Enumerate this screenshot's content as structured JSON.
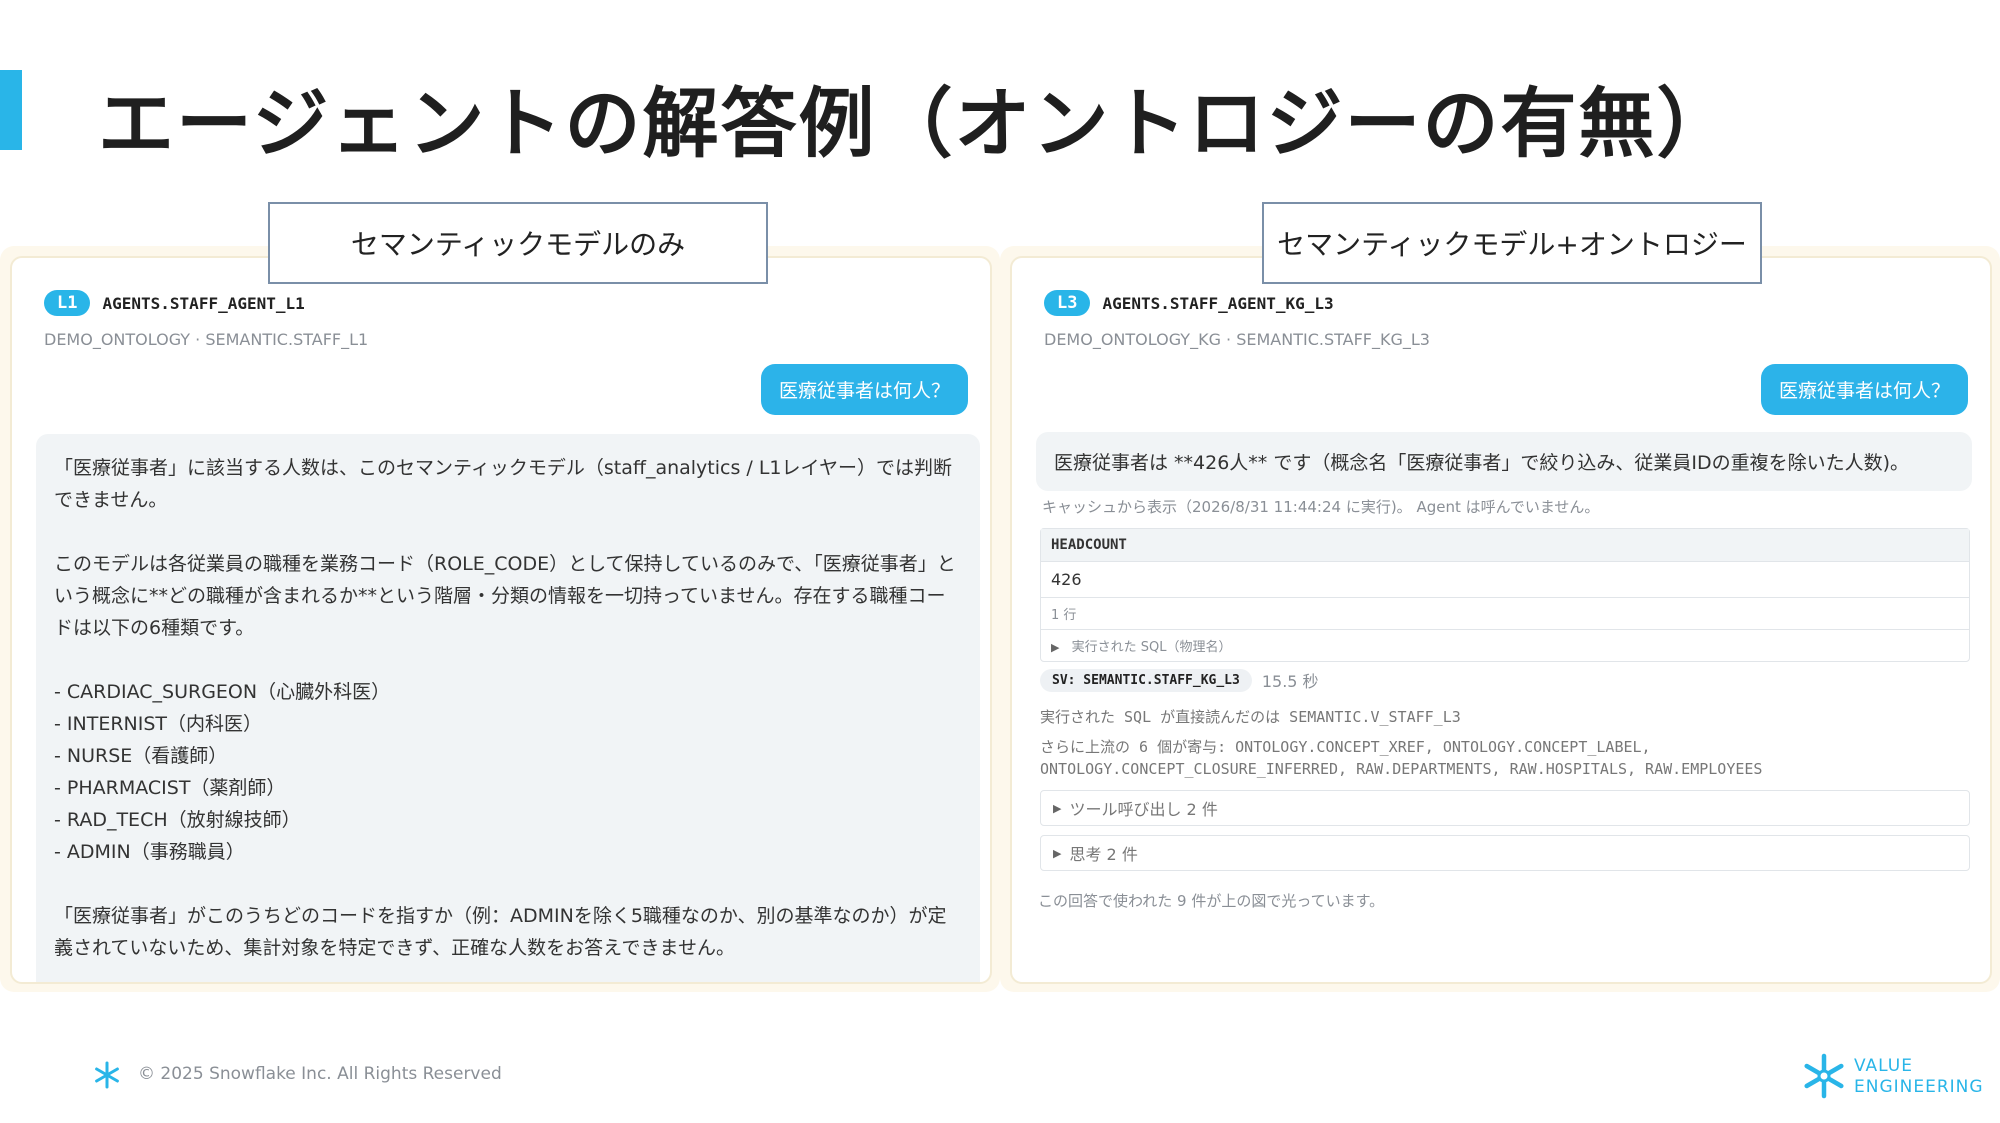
{
  "slide": {
    "title": "エージェントの解答例（オントロジーの有無）",
    "label_left": "セマンティックモデルのみ",
    "label_right": "セマンティックモデル+オントロジー"
  },
  "left_panel": {
    "level": "L1",
    "agent": "AGENTS.STAFF_AGENT_L1",
    "source": "DEMO_ONTOLOGY · SEMANTIC.STAFF_L1",
    "question": "医療従事者は何人？",
    "answer": {
      "p1": "「医療従事者」に該当する人数は、このセマンティックモデル（staff_analytics / L1レイヤー）では判断できません。",
      "p2": "このモデルは各従業員の職種を業務コード（ROLE_CODE）として保持しているのみで、「医療従事者」という概念に**どの職種が含まれるか**という階層・分類の情報を一切持っていません。存在する職種コードは以下の6種類です。",
      "roles": [
        "- CARDIAC_SURGEON（心臓外科医）",
        "- INTERNIST（内科医）",
        "- NURSE（看護師）",
        "- PHARMACIST（薬剤師）",
        "- RAD_TECH（放射線技師）",
        "- ADMIN（事務職員）"
      ],
      "p3": "「医療従事者」がこのうちどのコードを指すか（例：ADMINを除く5職種なのか、別の基準なのか）が定義されていないため、集計対象を特定できず、正確な人数をお答えできません。"
    }
  },
  "right_panel": {
    "level": "L3",
    "agent": "AGENTS.STAFF_AGENT_KG_L3",
    "source": "DEMO_ONTOLOGY_KG · SEMANTIC.STAFF_KG_L3",
    "question": "医療従事者は何人？",
    "answer": "医療従事者は **426人** です（概念名「医療従事者」で絞り込み、従業員IDの重複を除いた人数)。",
    "cache_note": "キャッシュから表示（2026/8/31 11:44:24 に実行)。 Agent は呼んでいません。",
    "table": {
      "header": "HEADCOUNT",
      "value": "426",
      "row_count": "1 行",
      "sql_toggle": "実行された SQL（物理名）"
    },
    "sv_badge": "SV: SEMANTIC.STAFF_KG_L3",
    "elapsed": "15.5 秒",
    "sql_read": "実行された SQL が直接読んだのは SEMANTIC.V_STAFF_L3",
    "upstream_line1": "さらに上流の 6 個が寄与: ONTOLOGY.CONCEPT_XREF, ONTOLOGY.CONCEPT_LABEL,",
    "upstream_line2": "ONTOLOGY.CONCEPT_CLOSURE_INFERRED, RAW.DEPARTMENTS, RAW.HOSPITALS, RAW.EMPLOYEES",
    "tool_calls": "ツール呼び出し 2 件",
    "thoughts": "思考 2 件",
    "glow_note": "この回答で使われた 9 件が上の図で光っています。"
  },
  "footer": {
    "copyright": "© 2025 Snowflake Inc. All Rights Reserved",
    "brand_line1": "VALUE",
    "brand_line2": "ENGINEERING"
  },
  "icons": {
    "footer_logo": "snowflake-icon",
    "brand_logo": "snowflake-icon",
    "toggle": "chevron-right-icon"
  },
  "colors": {
    "accent": "#29b5e8",
    "bubble": "#2cb3e9",
    "answer_bg": "#f1f4f6"
  }
}
